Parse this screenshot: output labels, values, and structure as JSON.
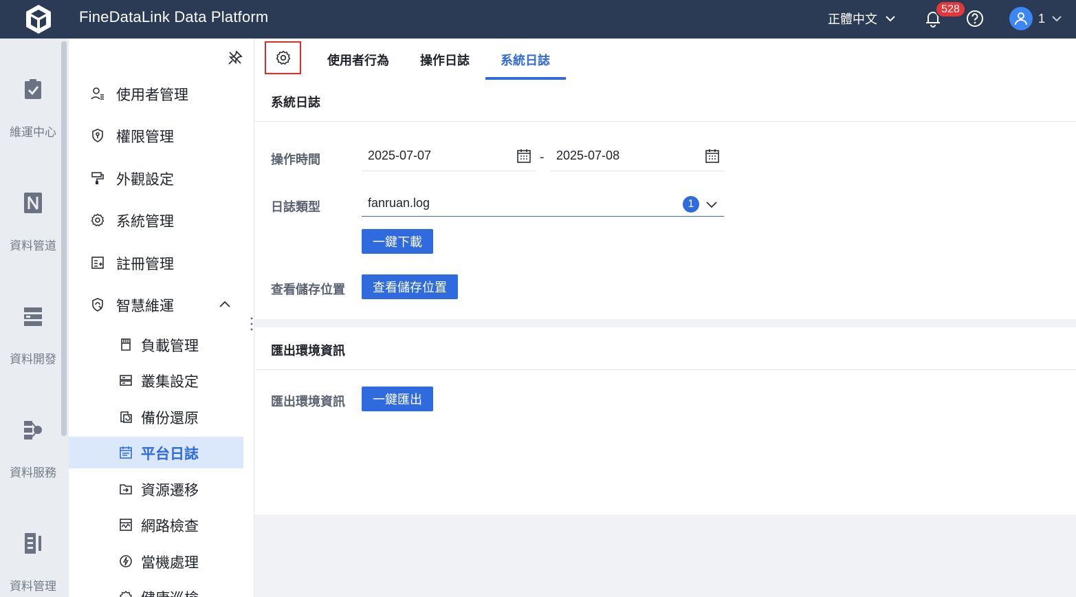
{
  "app": {
    "title": "FineDataLink Data Platform"
  },
  "header": {
    "language": "正體中文",
    "notification_count": "528",
    "user_name": "1"
  },
  "rail": {
    "items": [
      {
        "label": "維運中心",
        "icon": "clipboard-check-icon"
      },
      {
        "label": "資料管道",
        "icon": "pipeline-icon"
      },
      {
        "label": "資料開發",
        "icon": "data-dev-icon"
      },
      {
        "label": "資料服務",
        "icon": "data-service-icon"
      },
      {
        "label": "資料管理",
        "icon": "data-manage-icon"
      }
    ]
  },
  "sidebar": {
    "items": [
      {
        "label": "使用者管理",
        "icon": "user-manage-icon"
      },
      {
        "label": "權限管理",
        "icon": "shield-icon"
      },
      {
        "label": "外觀設定",
        "icon": "paint-roller-icon"
      },
      {
        "label": "系統管理",
        "icon": "gear-icon"
      },
      {
        "label": "註冊管理",
        "icon": "register-icon"
      },
      {
        "label": "智慧維運",
        "icon": "smart-ops-icon"
      }
    ],
    "sub_items": [
      {
        "label": "負載管理",
        "icon": "sd-card-icon"
      },
      {
        "label": "叢集設定",
        "icon": "server-icon"
      },
      {
        "label": "備份還原",
        "icon": "backup-icon"
      },
      {
        "label": "平台日誌",
        "icon": "calendar-log-icon"
      },
      {
        "label": "資源遷移",
        "icon": "migrate-icon"
      },
      {
        "label": "網路檢查",
        "icon": "network-check-icon"
      },
      {
        "label": "當機處理",
        "icon": "lightning-icon"
      },
      {
        "label": "健康巡檢",
        "icon": "health-icon"
      }
    ]
  },
  "tabs": [
    {
      "label": "使用者行為"
    },
    {
      "label": "操作日誌"
    },
    {
      "label": "系統日誌"
    }
  ],
  "system_log": {
    "title": "系統日誌",
    "time_label": "操作時間",
    "start_date": "2025-07-07",
    "range_separator": "-",
    "end_date": "2025-07-08",
    "type_label": "日誌類型",
    "type_value": "fanruan.log",
    "type_count": "1",
    "download_button": "一鍵下載",
    "storage_label": "查看儲存位置",
    "storage_button": "查看儲存位置"
  },
  "export_env": {
    "title": "匯出環境資訊",
    "label": "匯出環境資訊",
    "button": "一鍵匯出"
  },
  "colors": {
    "header_bg": "#2b3a55",
    "accent": "#2f6bdf",
    "badge": "#e3383b",
    "active_item_bg": "#dbe8fb",
    "highlight_border": "#e02b2b"
  }
}
